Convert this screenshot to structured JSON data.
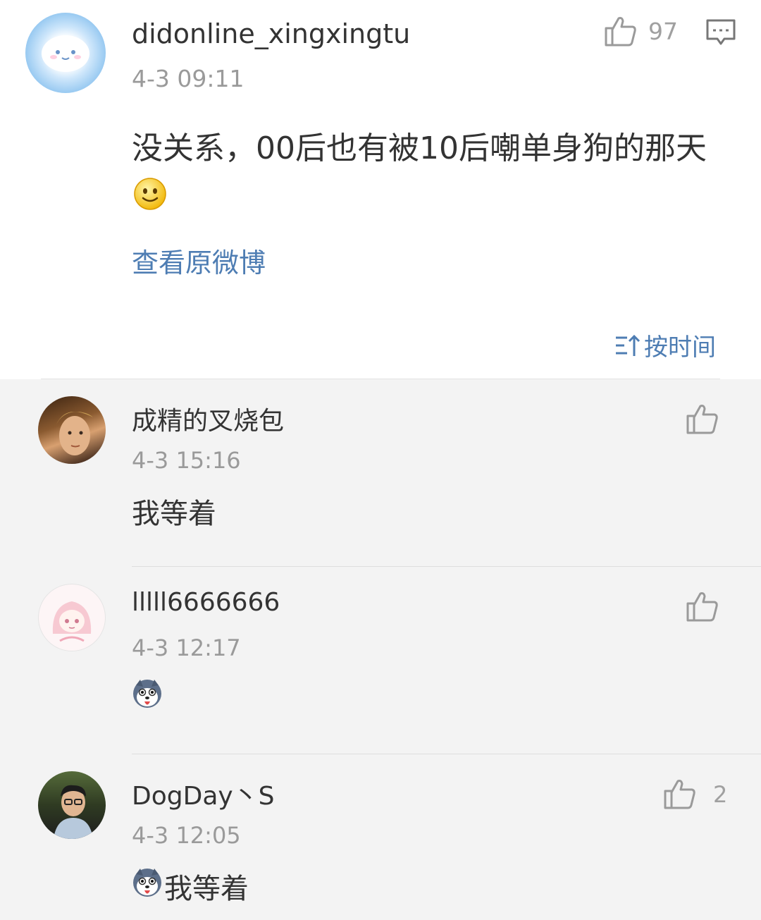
{
  "main_comment": {
    "username": "didonline_xingxingtu",
    "time": "4-3 09:11",
    "text": "没关系，00后也有被10后嘲单身狗的那天",
    "emoji_icon": "smiley-emoji-icon",
    "like_count": "97",
    "view_original_label": "查看原微博"
  },
  "sort": {
    "label": "按时间"
  },
  "replies": [
    {
      "username": "成精的叉烧包",
      "time": "4-3 15:16",
      "text": "我等着",
      "like_count": ""
    },
    {
      "username": "lllll6666666",
      "time": "4-3 12:17",
      "text": "",
      "emoji_icon": "husky-emoji-icon",
      "like_count": ""
    },
    {
      "username": "DogDay丶S",
      "time": "4-3 12:05",
      "text": "我等着",
      "emoji_icon": "husky-emoji-icon",
      "like_count": "2"
    }
  ],
  "colors": {
    "link": "#4e7db3",
    "text": "#333333",
    "muted": "#9a9a9a",
    "reply_bg": "#f3f3f3"
  }
}
